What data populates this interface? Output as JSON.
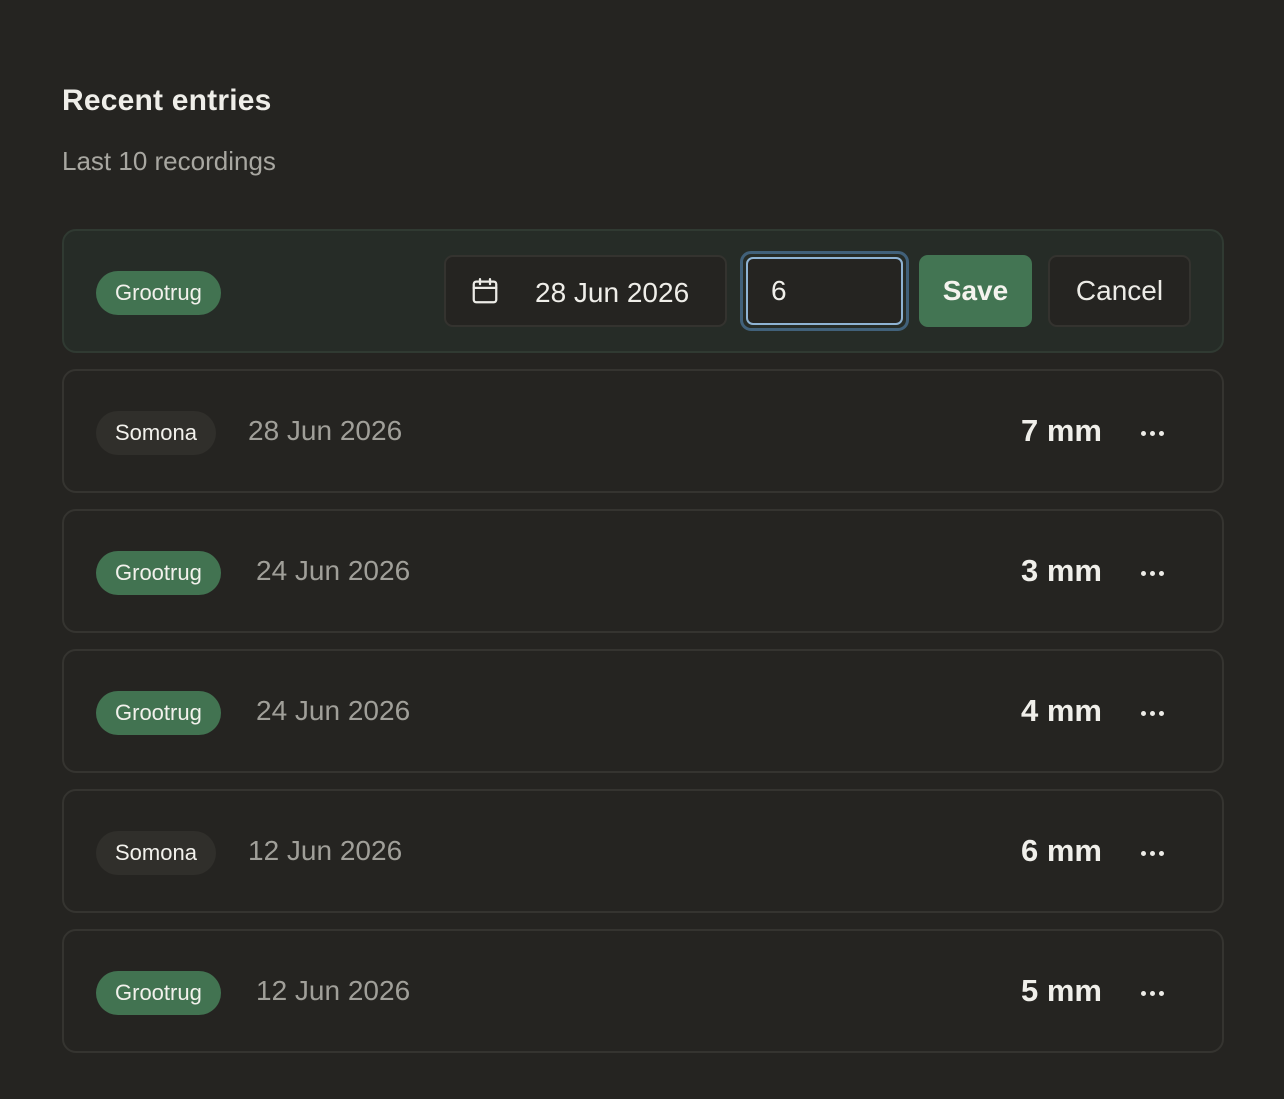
{
  "header": {
    "title": "Recent entries",
    "subtitle": "Last 10 recordings"
  },
  "editing_row": {
    "tag": "Grootrug",
    "tag_color": "#427351",
    "date": "28 Jun 2026",
    "value": "6",
    "save_label": "Save",
    "cancel_label": "Cancel"
  },
  "entries": [
    {
      "tag": "Somona",
      "tag_style": "dark",
      "date": "28 Jun 2026",
      "value": "7 mm"
    },
    {
      "tag": "Grootrug",
      "tag_style": "green",
      "date": "24 Jun 2026",
      "value": "3 mm"
    },
    {
      "tag": "Grootrug",
      "tag_style": "green",
      "date": "24 Jun 2026",
      "value": "4 mm"
    },
    {
      "tag": "Somona",
      "tag_style": "dark",
      "date": "12 Jun 2026",
      "value": "6 mm"
    },
    {
      "tag": "Grootrug",
      "tag_style": "green",
      "date": "12 Jun 2026",
      "value": "5 mm"
    }
  ],
  "colors": {
    "background": "#252421",
    "accent_green": "#437553",
    "focus_ring": "#8fb4d4"
  }
}
